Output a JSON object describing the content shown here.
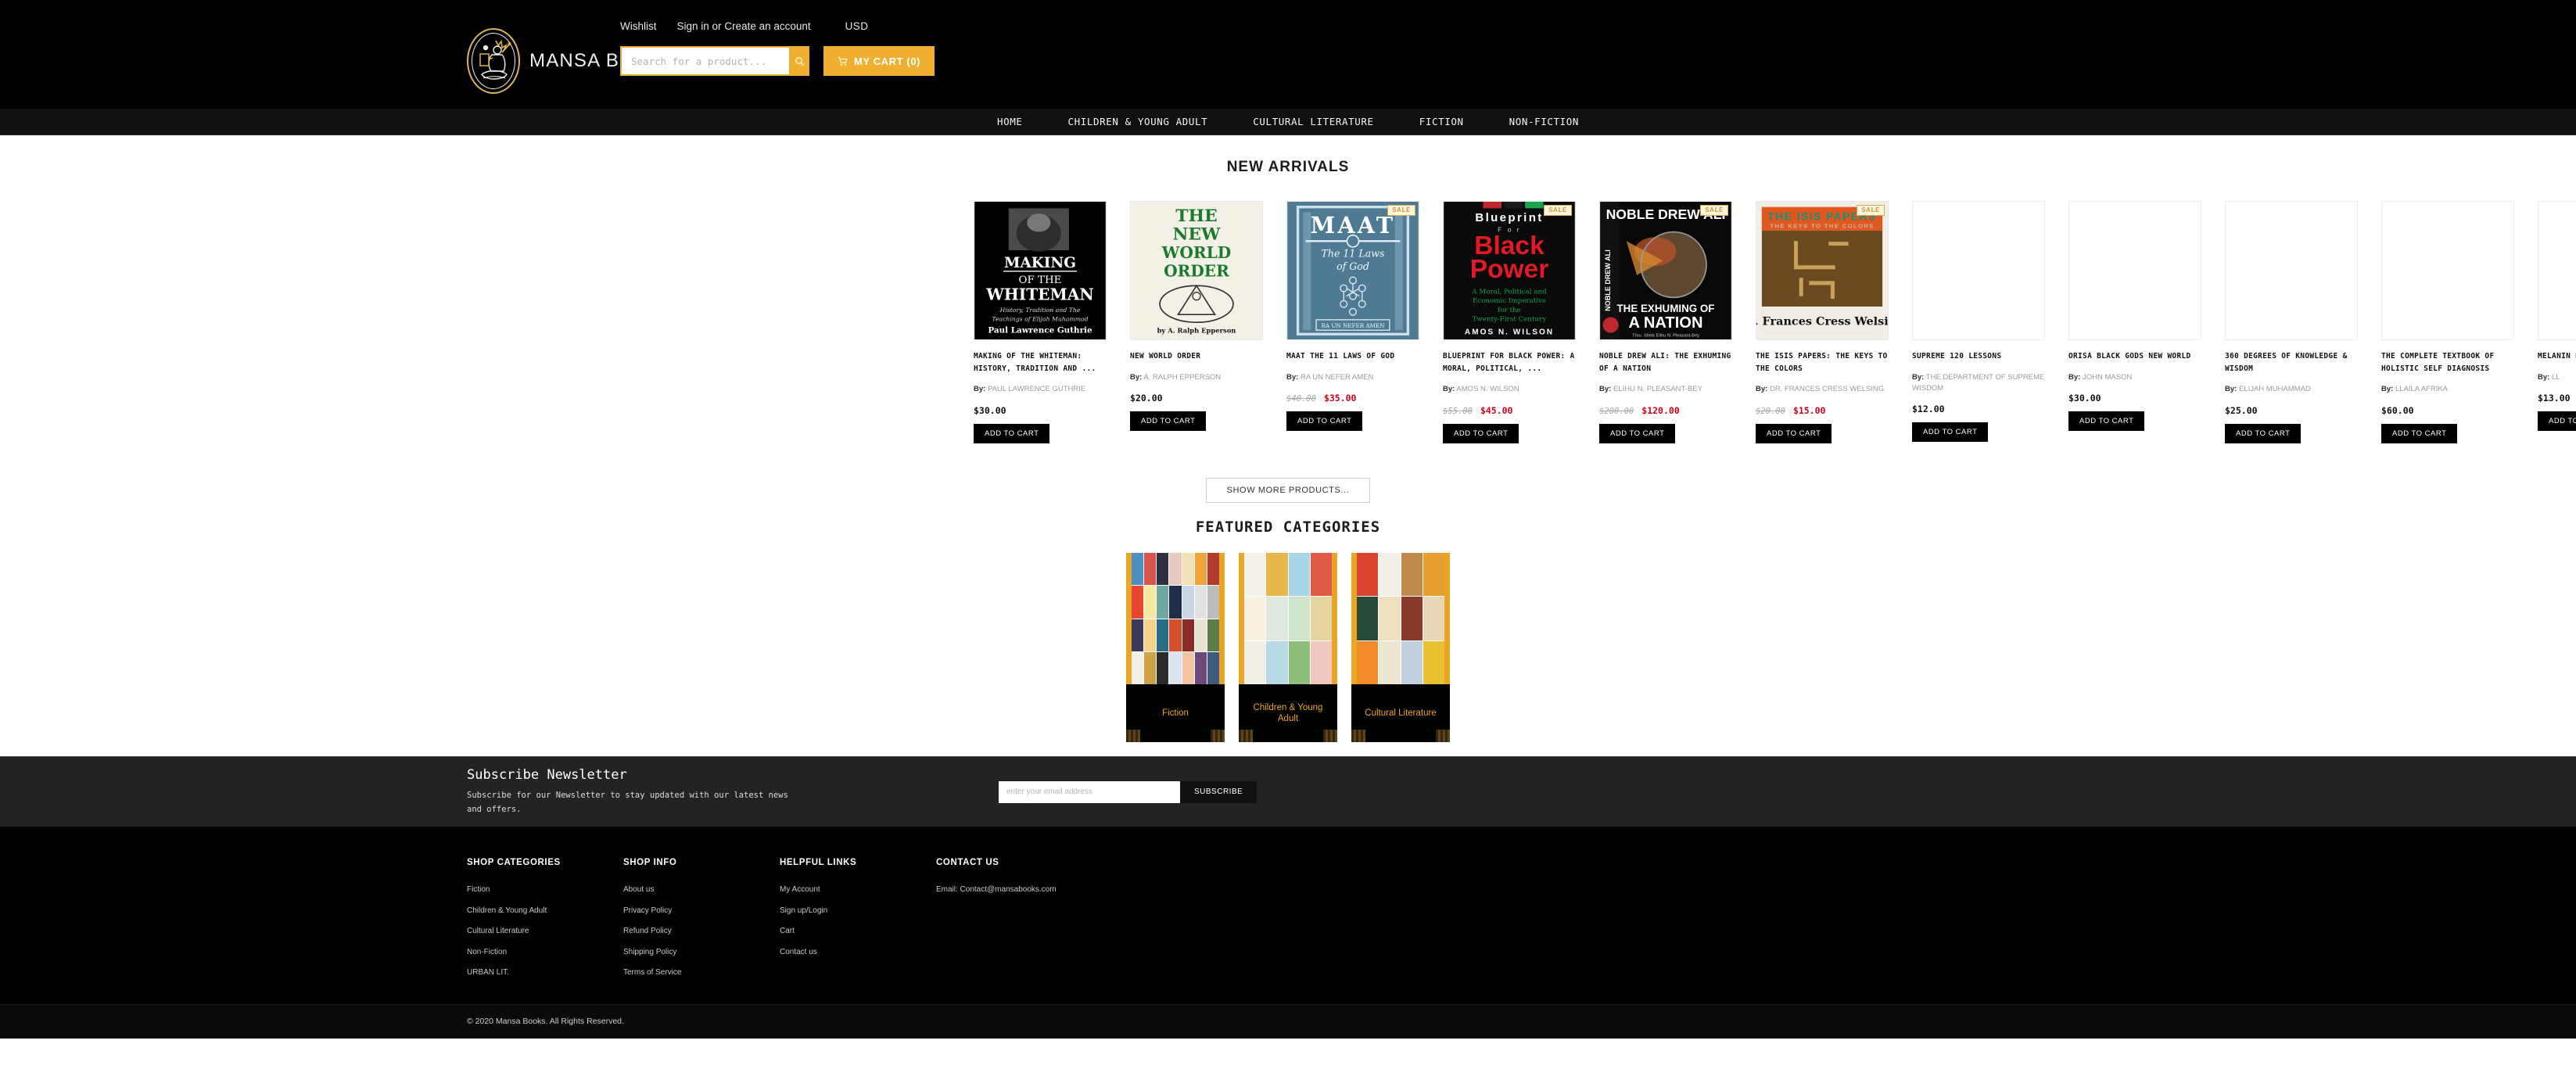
{
  "header": {
    "brand": "MANSA BOOKS",
    "logo_icon": "mansa-king-logo",
    "utility": {
      "wishlist": "Wishlist",
      "signin": "Sign in",
      "or": "or",
      "create_account": "Create an account",
      "currency": "USD"
    },
    "search": {
      "placeholder": "Search for a product...",
      "value": "",
      "icon": "search-icon"
    },
    "cart": {
      "label": "MY CART (0)",
      "icon": "cart-icon",
      "count": 0
    },
    "accent_color": "#eeb02e"
  },
  "nav": {
    "items": [
      {
        "label": "HOME"
      },
      {
        "label": "CHILDREN & YOUNG ADULT"
      },
      {
        "label": "CULTURAL LITERATURE"
      },
      {
        "label": "FICTION"
      },
      {
        "label": "NON-FICTION"
      }
    ]
  },
  "new_arrivals": {
    "title": "NEW ARRIVALS",
    "show_more_label": "SHOW MORE PRODUCTS...",
    "add_to_cart_label": "ADD TO CART",
    "by_label": "By:",
    "sale_badge": "SALE",
    "products": [
      {
        "title": "MAKING OF THE WHITEMAN: HISTORY, TRADITION AND ...",
        "author": "PAUL LAWRENCE GUTHRIE",
        "price": "$30.00",
        "old_price": "",
        "on_sale": false,
        "cover": "making-of-the-whiteman"
      },
      {
        "title": "NEW WORLD ORDER",
        "author": "A. RALPH EPPERSON",
        "price": "$20.00",
        "old_price": "",
        "on_sale": false,
        "cover": "new-world-order"
      },
      {
        "title": "MAAT THE 11 LAWS OF GOD",
        "author": "RA UN NEFER AMEN",
        "price": "$35.00",
        "old_price": "$40.00",
        "on_sale": true,
        "cover": "maat-11-laws"
      },
      {
        "title": "BLUEPRINT FOR BLACK POWER: A MORAL, POLITICAL, ...",
        "author": "AMOS N. WILSON",
        "price": "$45.00",
        "old_price": "$55.00",
        "on_sale": true,
        "cover": "blueprint-black-power"
      },
      {
        "title": "NOBLE DREW ALI: THE EXHUMING OF A NATION",
        "author": "ELIHU N. PLEASANT-BEY",
        "price": "$120.00",
        "old_price": "$200.00",
        "on_sale": true,
        "cover": "noble-drew-ali"
      },
      {
        "title": "THE ISIS PAPERS: THE KEYS TO THE COLORS",
        "author": "DR. FRANCES CRESS WELSING",
        "price": "$15.00",
        "old_price": "$20.00",
        "on_sale": true,
        "cover": "isis-papers"
      },
      {
        "title": "SUPREME 120 LESSONS",
        "author": "THE DEPARTMENT OF SUPREME WISDOM",
        "price": "$12.00",
        "old_price": "",
        "on_sale": false,
        "cover": "blank"
      },
      {
        "title": "ORISA BLACK GODS NEW WORLD",
        "author": "JOHN MASON",
        "price": "$30.00",
        "old_price": "",
        "on_sale": false,
        "cover": "blank"
      },
      {
        "title": "360 DEGREES OF KNOWLEDGE & WISDOM",
        "author": "ELIJAH MUHAMMAD",
        "price": "$25.00",
        "old_price": "",
        "on_sale": false,
        "cover": "blank"
      },
      {
        "title": "THE COMPLETE TEXTBOOK OF HOLISTIC SELF DIAGNOSIS",
        "author": "LLAILA AFRIKA",
        "price": "$60.00",
        "old_price": "",
        "on_sale": false,
        "cover": "blank"
      },
      {
        "title": "MELANIN BLACK",
        "author": "LL",
        "price": "$13.00",
        "old_price": "",
        "on_sale": false,
        "cover": "blank"
      }
    ]
  },
  "featured_categories": {
    "title": "FEATURED CATEGORIES",
    "items": [
      {
        "label": "Fiction",
        "image": "fiction-book-collage"
      },
      {
        "label": "Children & Young Adult",
        "image": "children-ya-book-collage"
      },
      {
        "label": "Cultural Literature",
        "image": "cultural-literature-book-collage"
      }
    ]
  },
  "newsletter": {
    "title": "Subscribe Newsletter",
    "subtitle": "Subscribe for our Newsletter to stay updated with our latest news and offers.",
    "input_placeholder": "enter your email address",
    "input_value": "",
    "button_label": "SUBSCRIBE"
  },
  "footer": {
    "columns": [
      {
        "heading": "SHOP CATEGORIES",
        "links": [
          "Fiction",
          "Children & Young Adult",
          "Cultural Literature",
          "Non-Fiction",
          "URBAN LIT."
        ]
      },
      {
        "heading": "SHOP INFO",
        "links": [
          "About us",
          "Privacy Policy",
          "Refund Policy",
          "Shipping Policy",
          "Terms of Service"
        ]
      },
      {
        "heading": "HELPFUL LINKS",
        "links": [
          "My Account",
          "Sign up/Login",
          "Cart",
          "Contact us"
        ]
      },
      {
        "heading": "CONTACT US",
        "links": [
          "Email: Contact@mansabooks.com"
        ]
      }
    ],
    "copyright": "© 2020 Mansa Books. All Rights Reserved."
  }
}
